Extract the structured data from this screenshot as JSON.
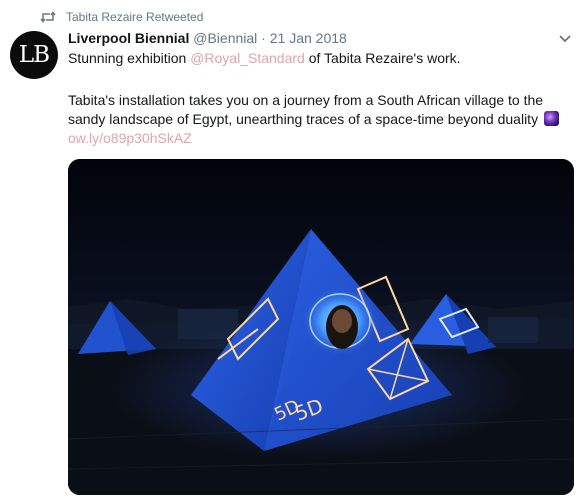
{
  "retweet": {
    "label": "Tabita Rezaire Retweeted",
    "icon": "retweet-icon"
  },
  "tweet": {
    "avatar_text": "LB",
    "display_name": "Liverpool Biennial",
    "handle": "@Biennial",
    "separator": "·",
    "date": "21 Jan 2018",
    "line1_prefix": "Stunning exhibition ",
    "mention": "@Royal_Standard",
    "line1_suffix": " of Tabita Rezaire's work.",
    "paragraph2": "Tabita's installation takes you on a journey from a South African village to the sandy landscape of Egypt, unearthing traces of a space-time beyond duality",
    "emoji": "milky-way-emoji",
    "short_link": "ow.ly/o89p30hSkAZ",
    "media": {
      "description_icon": "installation-photo",
      "labels": [
        "5D",
        "5D"
      ]
    }
  },
  "colors": {
    "link": "#e0a4a9",
    "muted": "#657786",
    "text": "#14171a",
    "pyramid_blue": "#1f4fd1"
  }
}
